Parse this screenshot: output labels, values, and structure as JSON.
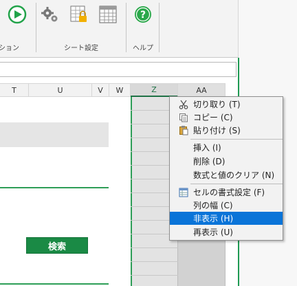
{
  "ribbon": {
    "groups": [
      {
        "label": "ション"
      },
      {
        "label": "シート設定"
      },
      {
        "label": "ヘルプ"
      }
    ]
  },
  "columns": [
    "T",
    "U",
    "V",
    "W",
    "Z",
    "AA"
  ],
  "selected_column": "Z",
  "sheet": {
    "search_button": "検索"
  },
  "context_menu": {
    "items": [
      {
        "label": "切り取り (T)",
        "icon": "scissors-icon"
      },
      {
        "label": "コピー (C)",
        "icon": "copy-icon"
      },
      {
        "label": "貼り付け (S)",
        "icon": "paste-icon"
      },
      {
        "label": "挿入 (I)"
      },
      {
        "label": "削除 (D)"
      },
      {
        "label": "数式と値のクリア (N)"
      },
      {
        "label": "セルの書式設定 (F)",
        "icon": "format-cells-icon"
      },
      {
        "label": "列の幅 (C)"
      },
      {
        "label": "非表示 (H)",
        "highlighted": true
      },
      {
        "label": "再表示 (U)"
      }
    ]
  },
  "colors": {
    "accent_green": "#1a8a45",
    "menu_highlight": "#0a74d8"
  }
}
